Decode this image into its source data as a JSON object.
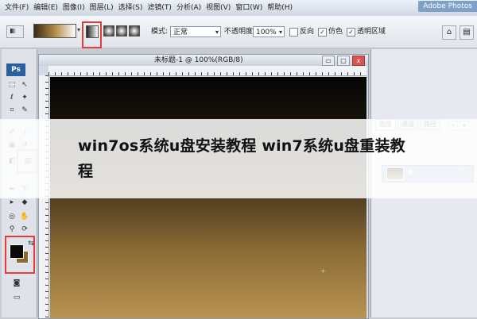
{
  "app": {
    "title": "Adobe Photos",
    "menu": [
      "文件(F)",
      "编辑(E)",
      "图像(I)",
      "图层(L)",
      "选择(S)",
      "滤镜(T)",
      "分析(A)",
      "视图(V)",
      "窗口(W)",
      "帮助(H)"
    ]
  },
  "options": {
    "mode_label": "模式:",
    "mode_value": "正常",
    "opacity_label": "不透明度:",
    "opacity_value": "100%",
    "reverse_label": "反向",
    "dither_label": "仿色",
    "transparency_label": "透明区域"
  },
  "toolbox": {
    "logo": "Ps"
  },
  "document": {
    "title": "未标题-1 @ 100%(RGB/8)",
    "btn_min": "▭",
    "btn_max": "□",
    "btn_close": "x",
    "marker": "+"
  },
  "panels": {
    "tabs": [
      "图层",
      "通道",
      "路径"
    ]
  },
  "banner": {
    "text": "win7os系统u盘安装教程 win7系统u盘重装教程"
  },
  "colors": {
    "foreground": "#0b0a08",
    "background": "#8a6a2b",
    "highlight": "#e53b3b"
  }
}
